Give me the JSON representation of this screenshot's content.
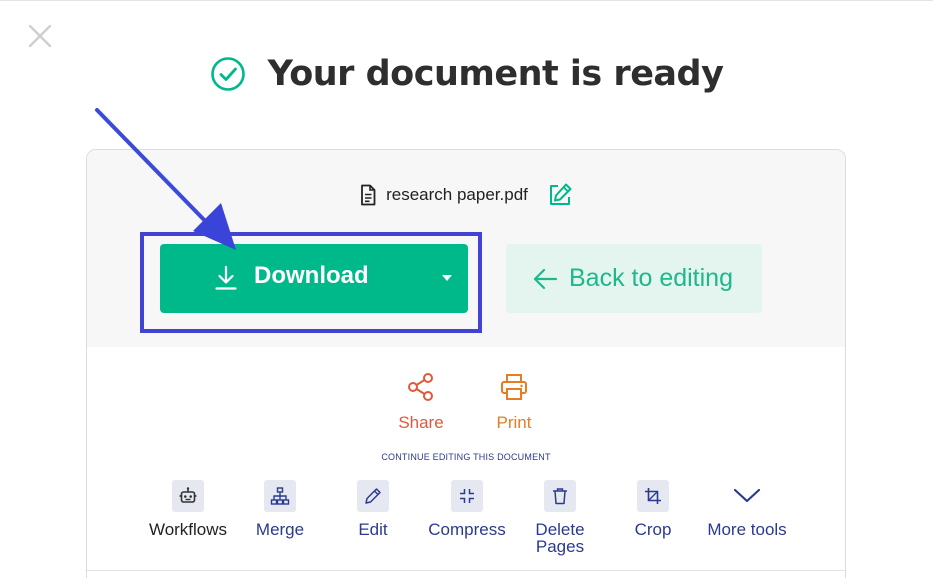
{
  "dialog": {
    "title": "Your document is ready"
  },
  "file": {
    "name": "research paper.pdf"
  },
  "buttons": {
    "download_label": "Download",
    "back_label": "Back to editing"
  },
  "actions": [
    {
      "label": "Share",
      "icon": "share-icon",
      "color": "#e0593a"
    },
    {
      "label": "Print",
      "icon": "printer-icon",
      "color": "#e77c22"
    }
  ],
  "continue_label": "CONTINUE EDITING THIS DOCUMENT",
  "tools": [
    {
      "label": "Workflows",
      "icon": "robot-icon"
    },
    {
      "label": "Merge",
      "icon": "sitemap-icon"
    },
    {
      "label": "Edit",
      "icon": "pencil-icon"
    },
    {
      "label": "Compress",
      "icon": "compress-icon"
    },
    {
      "label": "Delete\nPages",
      "icon": "trash-icon"
    },
    {
      "label": "Crop",
      "icon": "crop-icon"
    },
    {
      "label": "More tools",
      "icon": "chevron-down-icon"
    }
  ],
  "colors": {
    "accent_green": "#00b98a",
    "back_bg": "#e4f5ef",
    "tool_blue": "#2b3a8f",
    "annotation_blue": "#4243d4"
  }
}
